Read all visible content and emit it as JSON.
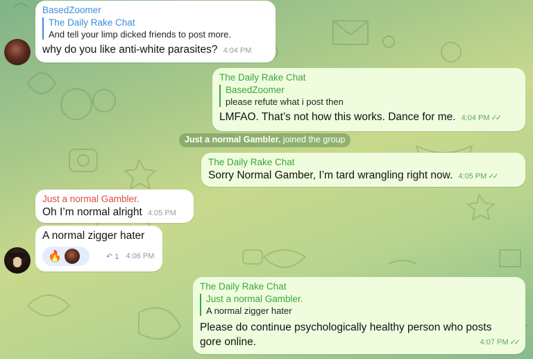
{
  "messages": [
    {
      "sender": "BasedZoomer",
      "reply_to": {
        "name": "The Daily Rake Chat",
        "text": "And tell your limp dicked friends to post more."
      },
      "text": "why do you like anti-white parasites?",
      "time": "4:04 PM"
    },
    {
      "sender": "The Daily Rake Chat",
      "reply_to": {
        "name": "BasedZoomer",
        "text": "please refute what i post then"
      },
      "text": "LMFAO. That’s not how this works. Dance for me.",
      "time": "4:04 PM"
    },
    {
      "service": {
        "name": "Just a normal Gambler.",
        "action": "joined the group"
      }
    },
    {
      "sender": "The Daily Rake Chat",
      "text": "Sorry Normal Gamber, I’m tard wrangling right now.",
      "time": "4:05 PM"
    },
    {
      "sender": "Just a normal Gambler.",
      "text": "Oh I’m normal alright",
      "time": "4:05 PM"
    },
    {
      "text": "A normal zigger hater",
      "reaction": {
        "emoji": "🔥",
        "icon": "fire-icon"
      },
      "reply_count": "↶ 1",
      "time": "4:06 PM"
    },
    {
      "sender": "The Daily Rake Chat",
      "reply_to": {
        "name": "Just a normal Gambler.",
        "text": "A normal zigger hater"
      },
      "text_line1": "Please do continue psychologically healthy person who posts",
      "text_line2": "gore online.",
      "time": "4:07 PM"
    }
  ],
  "check_glyph": "✓✓",
  "colors": {
    "incoming_bubble": "#ffffff",
    "outgoing_bubble": "#effdde",
    "name_blue": "#3a8ed8",
    "name_green": "#3ba53b",
    "name_red": "#e0493a"
  }
}
